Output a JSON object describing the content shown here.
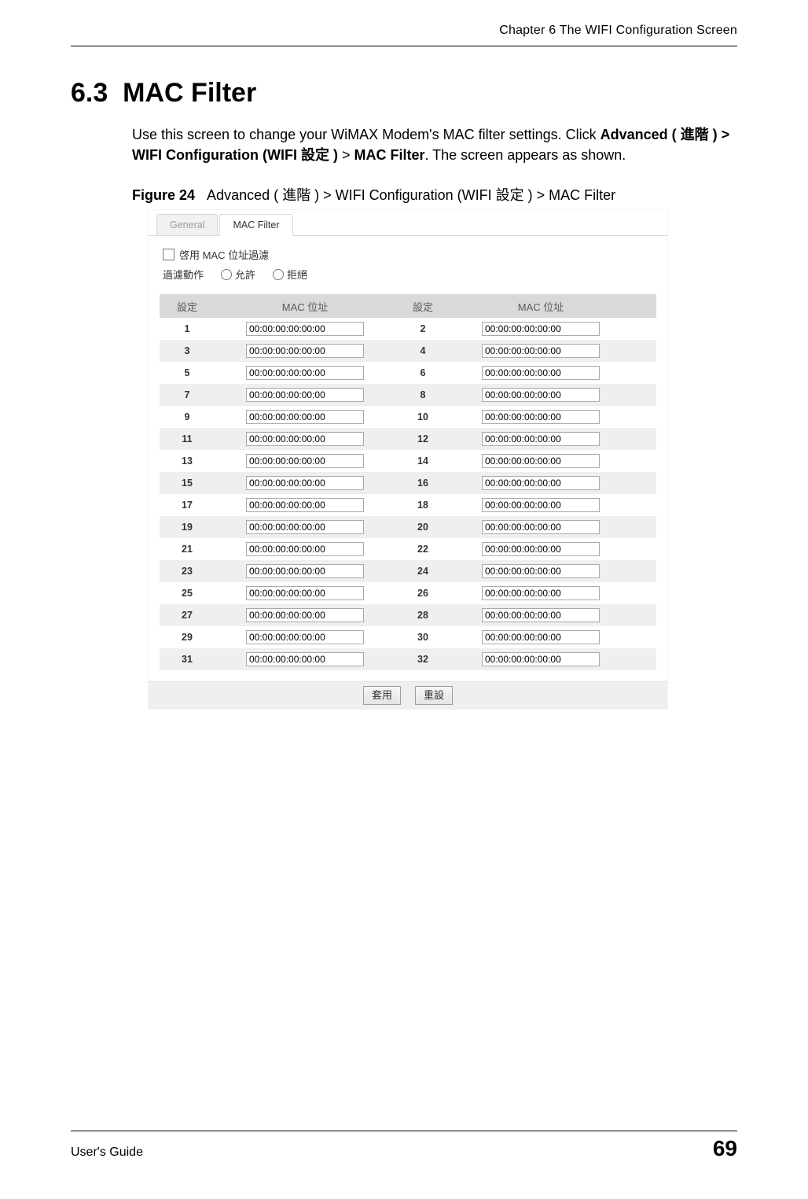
{
  "header": {
    "chapter_title": "Chapter 6 The WIFI Configuration Screen"
  },
  "section": {
    "number": "6.3",
    "title": "MAC Filter"
  },
  "paragraph": {
    "p1": "Use this screen to change your WiMAX Modem's MAC filter settings. Click ",
    "b1": "Advanced ( 進階 ) > WIFI Configuration (WIFI 設定 )",
    "p2": " > ",
    "b2": "MAC Filter",
    "p3": ". The screen appears as shown."
  },
  "figure": {
    "label": "Figure 24",
    "caption": "Advanced ( 進階 ) > WIFI Configuration (WIFI 設定 ) > MAC Filter"
  },
  "screenshot": {
    "tabs": {
      "general": "General",
      "mac_filter": "MAC Filter"
    },
    "enable_label": "啓用 MAC 位址過濾",
    "action_label": "過濾動作",
    "allow_label": "允許",
    "deny_label": "拒絕",
    "headers": {
      "set": "設定",
      "mac": "MAC 位址"
    },
    "rows": [
      {
        "i1": "1",
        "m1": "00:00:00:00:00:00",
        "i2": "2",
        "m2": "00:00:00:00:00:00"
      },
      {
        "i1": "3",
        "m1": "00:00:00:00:00:00",
        "i2": "4",
        "m2": "00:00:00:00:00:00"
      },
      {
        "i1": "5",
        "m1": "00:00:00:00:00:00",
        "i2": "6",
        "m2": "00:00:00:00:00:00"
      },
      {
        "i1": "7",
        "m1": "00:00:00:00:00:00",
        "i2": "8",
        "m2": "00:00:00:00:00:00"
      },
      {
        "i1": "9",
        "m1": "00:00:00:00:00:00",
        "i2": "10",
        "m2": "00:00:00:00:00:00"
      },
      {
        "i1": "11",
        "m1": "00:00:00:00:00:00",
        "i2": "12",
        "m2": "00:00:00:00:00:00"
      },
      {
        "i1": "13",
        "m1": "00:00:00:00:00:00",
        "i2": "14",
        "m2": "00:00:00:00:00:00"
      },
      {
        "i1": "15",
        "m1": "00:00:00:00:00:00",
        "i2": "16",
        "m2": "00:00:00:00:00:00"
      },
      {
        "i1": "17",
        "m1": "00:00:00:00:00:00",
        "i2": "18",
        "m2": "00:00:00:00:00:00"
      },
      {
        "i1": "19",
        "m1": "00:00:00:00:00:00",
        "i2": "20",
        "m2": "00:00:00:00:00:00"
      },
      {
        "i1": "21",
        "m1": "00:00:00:00:00:00",
        "i2": "22",
        "m2": "00:00:00:00:00:00"
      },
      {
        "i1": "23",
        "m1": "00:00:00:00:00:00",
        "i2": "24",
        "m2": "00:00:00:00:00:00"
      },
      {
        "i1": "25",
        "m1": "00:00:00:00:00:00",
        "i2": "26",
        "m2": "00:00:00:00:00:00"
      },
      {
        "i1": "27",
        "m1": "00:00:00:00:00:00",
        "i2": "28",
        "m2": "00:00:00:00:00:00"
      },
      {
        "i1": "29",
        "m1": "00:00:00:00:00:00",
        "i2": "30",
        "m2": "00:00:00:00:00:00"
      },
      {
        "i1": "31",
        "m1": "00:00:00:00:00:00",
        "i2": "32",
        "m2": "00:00:00:00:00:00"
      }
    ],
    "buttons": {
      "apply": "套用",
      "reset": "重設"
    }
  },
  "footer": {
    "guide": "User's Guide",
    "page": "69"
  }
}
